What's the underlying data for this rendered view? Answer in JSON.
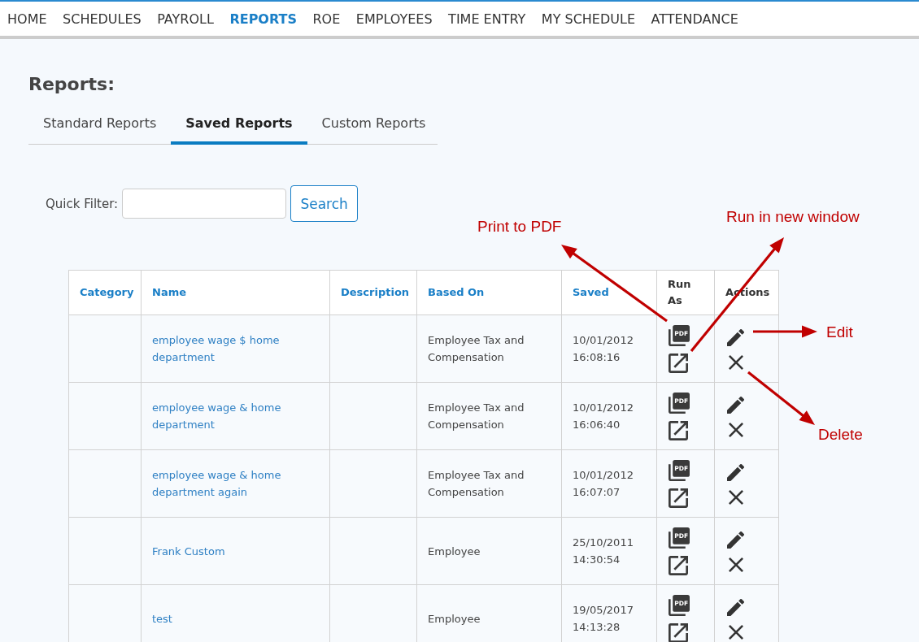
{
  "nav": [
    {
      "label": "HOME",
      "selected": false
    },
    {
      "label": "SCHEDULES",
      "selected": false
    },
    {
      "label": "PAYROLL",
      "selected": false
    },
    {
      "label": "REPORTS",
      "selected": true
    },
    {
      "label": "ROE",
      "selected": false
    },
    {
      "label": "EMPLOYEES",
      "selected": false
    },
    {
      "label": "TIME ENTRY",
      "selected": false
    },
    {
      "label": "MY SCHEDULE",
      "selected": false
    },
    {
      "label": "ATTENDANCE",
      "selected": false
    }
  ],
  "page_title": "Reports:",
  "tabs": [
    {
      "label": "Standard Reports",
      "selected": false
    },
    {
      "label": "Saved Reports",
      "selected": true
    },
    {
      "label": "Custom Reports",
      "selected": false
    }
  ],
  "filter": {
    "label": "Quick Filter:",
    "button": "Search"
  },
  "table": {
    "columns": [
      {
        "label": "Category",
        "sortable": true
      },
      {
        "label": "Name",
        "sortable": true
      },
      {
        "label": "Description",
        "sortable": true
      },
      {
        "label": "Based On",
        "sortable": true
      },
      {
        "label": "Saved",
        "sortable": true
      },
      {
        "label": "Run As",
        "sortable": false
      },
      {
        "label": "Actions",
        "sortable": false
      }
    ],
    "rows": [
      {
        "name": "employee wage $ home department",
        "based_on": "Employee Tax and Compensation",
        "saved": "10/01/2012 16:08:16",
        "run_as": [
          {
            "kind": "pdf",
            "label": "PDF"
          },
          {
            "kind": "new_window"
          }
        ],
        "actions": [
          {
            "kind": "edit"
          },
          {
            "kind": "delete"
          }
        ]
      },
      {
        "name": "employee wage & home department",
        "based_on": "Employee Tax and Compensation",
        "saved": "10/01/2012 16:06:40",
        "run_as": [
          {
            "kind": "pdf",
            "label": "PDF"
          },
          {
            "kind": "new_window"
          }
        ],
        "actions": [
          {
            "kind": "edit"
          },
          {
            "kind": "delete"
          }
        ]
      },
      {
        "name": "employee wage & home department again",
        "based_on": "Employee Tax and Compensation",
        "saved": "10/01/2012 16:07:07",
        "run_as": [
          {
            "kind": "pdf",
            "label": "PDF"
          },
          {
            "kind": "new_window"
          }
        ],
        "actions": [
          {
            "kind": "edit"
          },
          {
            "kind": "delete"
          }
        ]
      },
      {
        "name": "Frank Custom",
        "based_on": "Employee",
        "saved": "25/10/2011 14:30:54",
        "run_as": [
          {
            "kind": "pdf",
            "label": "PDF"
          },
          {
            "kind": "new_window"
          }
        ],
        "actions": [
          {
            "kind": "edit"
          },
          {
            "kind": "delete"
          }
        ]
      },
      {
        "name": "test",
        "based_on": "Employee",
        "saved": "19/05/2017 14:13:28",
        "run_as": [
          {
            "kind": "pdf",
            "label": "PDF"
          },
          {
            "kind": "new_window"
          }
        ],
        "actions": [
          {
            "kind": "edit"
          },
          {
            "kind": "delete"
          }
        ]
      }
    ]
  },
  "annotations": [
    {
      "label": "Print to PDF"
    },
    {
      "label": "Run in new window"
    },
    {
      "label": "Edit"
    },
    {
      "label": "Delete"
    }
  ]
}
